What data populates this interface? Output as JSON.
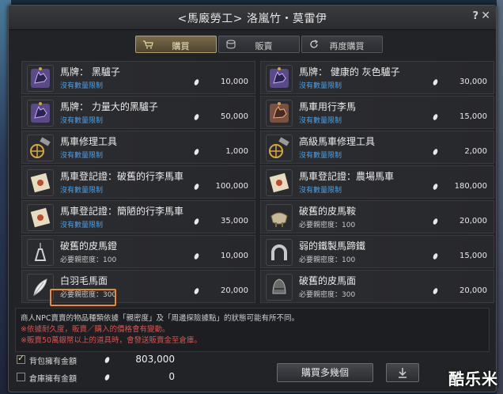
{
  "window": {
    "title": "<馬廄勞工> 洛嵐竹・莫雷伊",
    "help": "?",
    "close": "✕"
  },
  "tabs": [
    {
      "label": "購買",
      "icon": "cart-icon",
      "active": true
    },
    {
      "label": "販賣",
      "icon": "coins-icon",
      "active": false
    },
    {
      "label": "再度購買",
      "icon": "refresh-icon",
      "active": false
    }
  ],
  "items": [
    {
      "name": "馬牌： 黑驢子",
      "sub": "沒有數量限制",
      "sub_color": "blue",
      "price": "10,000",
      "icon": "donkey-badge-icon"
    },
    {
      "name": "馬牌： 健康的 灰色驢子",
      "sub": "沒有數量限制",
      "sub_color": "blue",
      "price": "30,000",
      "icon": "donkey-badge-icon"
    },
    {
      "name": "馬牌： 力量大的黑驢子",
      "sub": "沒有數量限制",
      "sub_color": "blue",
      "price": "50,000",
      "icon": "donkey-badge-icon"
    },
    {
      "name": "馬車用行李馬",
      "sub": "沒有數量限制",
      "sub_color": "blue",
      "price": "15,000",
      "icon": "horse-badge-icon"
    },
    {
      "name": "馬車修理工具",
      "sub": "沒有數量限制",
      "sub_color": "blue",
      "price": "1,000",
      "icon": "repair-tool-icon"
    },
    {
      "name": "高級馬車修理工具",
      "sub": "沒有數量限制",
      "sub_color": "blue",
      "price": "2,000",
      "icon": "repair-tool-icon"
    },
    {
      "name": "馬車登記證：破舊的行李馬車",
      "sub": "沒有數量限制",
      "sub_color": "blue",
      "price": "100,000",
      "icon": "license-icon"
    },
    {
      "name": "馬車登記證：農場馬車",
      "sub": "沒有數量限制",
      "sub_color": "blue",
      "price": "180,000",
      "icon": "license-icon"
    },
    {
      "name": "馬車登記證：簡陋的行李馬車",
      "sub": "沒有數量限制",
      "sub_color": "blue",
      "price": "35,000",
      "icon": "license-icon"
    },
    {
      "name": "破舊的皮馬鞍",
      "sub": "必要親密度：100",
      "sub_color": "white",
      "price": "20,000",
      "icon": "saddle-icon"
    },
    {
      "name": "破舊的皮馬鐙",
      "sub": "必要親密度：100",
      "sub_color": "white",
      "price": "10,000",
      "icon": "stirrup-icon"
    },
    {
      "name": "弱的鐵製馬蹄鐵",
      "sub": "必要親密度：100",
      "sub_color": "white",
      "price": "15,000",
      "icon": "horseshoe-icon"
    },
    {
      "name": "白羽毛馬面",
      "sub": "必要親密度：300",
      "sub_color": "white",
      "price": "20,000",
      "icon": "feather-icon"
    },
    {
      "name": "破舊的皮馬面",
      "sub": "必要親密度：300",
      "sub_color": "white",
      "price": "20,000",
      "icon": "helmet-icon"
    }
  ],
  "notice": {
    "line1": "商人NPC賣賣的物品種類依據「親密度」及「周邊探險據點」的狀態可能有所不同。",
    "line2": "※依據耐久度，販賣／購入的價格會有變動。",
    "line3": "※販賣50萬銀幣以上的道具時，會發送販賣金至倉庫。"
  },
  "money": {
    "bag_label": "背包擁有金額",
    "bag_value": "803,000",
    "bag_checked": true,
    "warehouse_label": "倉庫擁有金額",
    "warehouse_value": "0",
    "warehouse_checked": false
  },
  "buttons": {
    "buy_multi": "購買多幾個"
  },
  "watermark": "酷乐米",
  "colors": {
    "accent": "#f08a24",
    "blue_text": "#4aa0e8",
    "warning_text": "#e05050"
  }
}
